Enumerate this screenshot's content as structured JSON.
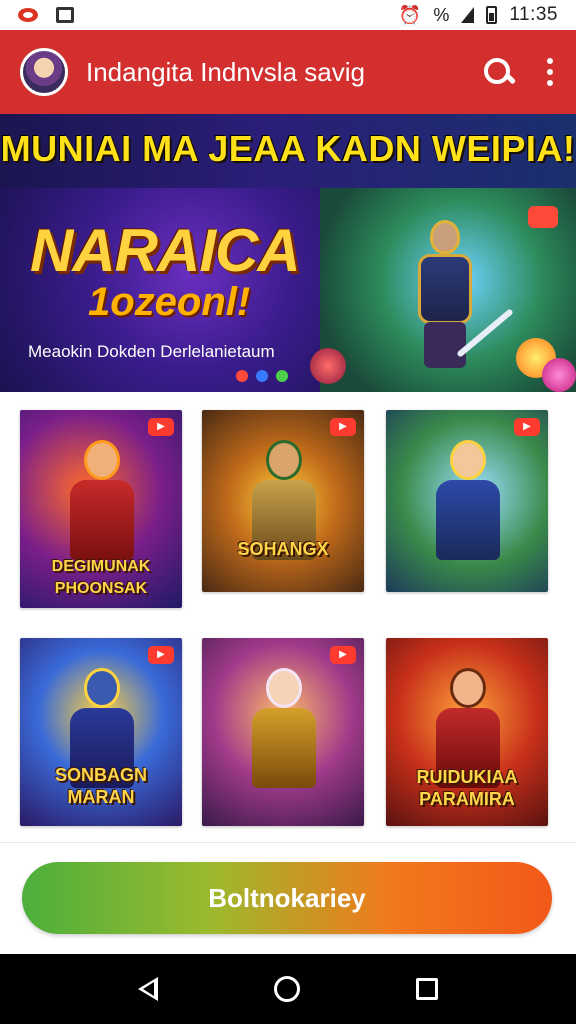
{
  "status_bar": {
    "time": "11:35",
    "battery_text": "%"
  },
  "app_bar": {
    "title": "Indangita Indnvsla savig"
  },
  "banner": {
    "headline": "MUNIAI MA JEAA KADN WEIPIA!",
    "title": "NARAICA",
    "subtitle": "1ozeonl!",
    "tagline": "Meaokin Dokden Derlelanietaum",
    "colors": [
      "#ffe11a",
      "#ffd23f"
    ]
  },
  "games": [
    {
      "caption": "DEGIMUNAK PHOONSAK",
      "badge": ""
    },
    {
      "caption": "SOHANGX",
      "badge": ""
    },
    {
      "caption": "",
      "badge": ""
    },
    {
      "caption": "SONBAGN MARAN",
      "badge": ""
    },
    {
      "caption": "",
      "badge": ""
    },
    {
      "caption": "RUIDUKIAA PARAMIRA",
      "badge": ""
    }
  ],
  "cta": {
    "label": "Boltnokariey",
    "colors": [
      "#4caf3c",
      "#f2591a"
    ]
  },
  "theme": {
    "app_bar_color": "#d32f2f",
    "nav_bar_color": "#000000"
  }
}
